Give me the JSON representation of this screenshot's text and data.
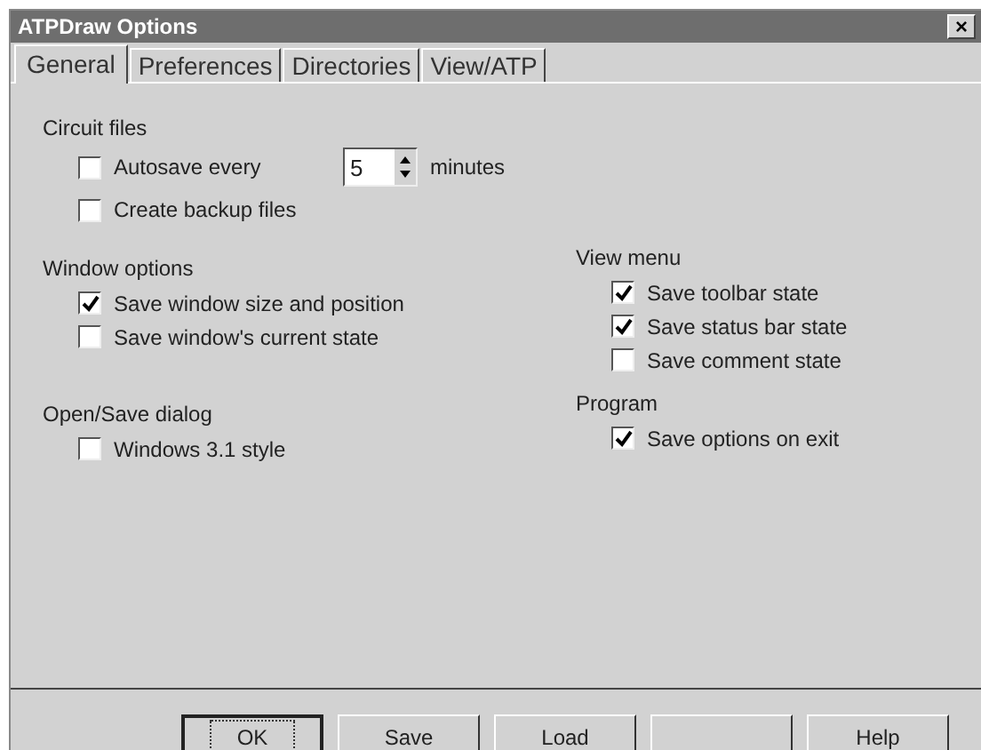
{
  "window": {
    "title": "ATPDraw Options",
    "close": "×"
  },
  "tabs": [
    {
      "label": "General",
      "selected": true
    },
    {
      "label": "Preferences",
      "selected": false
    },
    {
      "label": "Directories",
      "selected": false
    },
    {
      "label": "View/ATP",
      "selected": false
    }
  ],
  "circuit_files": {
    "title": "Circuit files",
    "autosave": {
      "label": "Autosave every",
      "checked": false,
      "value": "5",
      "unit": "minutes"
    },
    "backup": {
      "label": "Create backup files",
      "checked": false
    }
  },
  "window_options": {
    "title": "Window options",
    "items": [
      {
        "label": "Save window size and position",
        "checked": true
      },
      {
        "label": "Save window's current state",
        "checked": false
      }
    ]
  },
  "view_menu": {
    "title": "View menu",
    "items": [
      {
        "label": "Save toolbar state",
        "checked": true
      },
      {
        "label": "Save status bar state",
        "checked": true
      },
      {
        "label": "Save comment state",
        "checked": false
      }
    ]
  },
  "open_save_dialog": {
    "title": "Open/Save dialog",
    "items": [
      {
        "label": "Windows 3.1 style",
        "checked": false
      }
    ]
  },
  "program": {
    "title": "Program",
    "items": [
      {
        "label": "Save options on exit",
        "checked": true
      }
    ]
  },
  "buttons": [
    {
      "kind": "default",
      "label": "OK"
    },
    {
      "kind": "normal",
      "label": "Save"
    },
    {
      "kind": "normal",
      "label": "Load"
    },
    {
      "kind": "blank"
    },
    {
      "kind": "normal",
      "label": "Help"
    }
  ]
}
